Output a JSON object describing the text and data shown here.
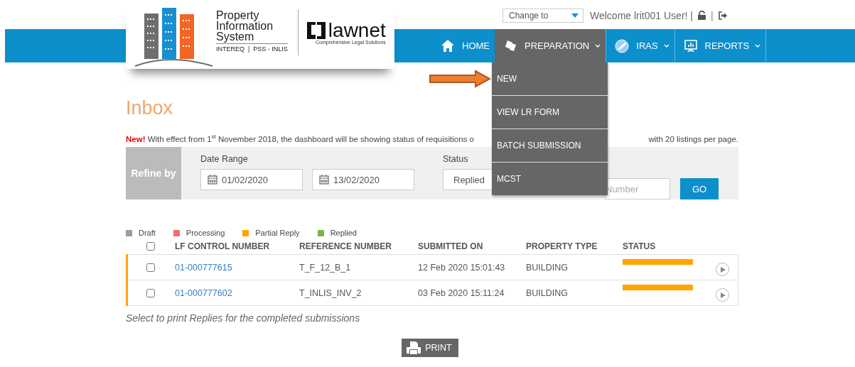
{
  "logo": {
    "title_lines": [
      "Property",
      "Information",
      "System"
    ],
    "tagline": "INTEREQ  |  PSS - INLIS",
    "partner": "lawnet",
    "partner_tagline": "Comprehensive Legal Solutions"
  },
  "top_bar": {
    "role_select": "Change to",
    "welcome": "Welcome lrit001 User!",
    "separator": "|"
  },
  "nav": [
    {
      "label": "HOME",
      "kind": "home",
      "dropdown": false,
      "selected": false
    },
    {
      "label": "PREPARATION",
      "kind": "documents",
      "dropdown": true,
      "selected": true
    },
    {
      "label": "IRAS",
      "kind": "globe",
      "dropdown": true,
      "selected": false
    },
    {
      "label": "REPORTS",
      "kind": "reports",
      "dropdown": true,
      "selected": false
    }
  ],
  "menu": [
    {
      "label": "NEW"
    },
    {
      "label": "VIEW LR FORM"
    },
    {
      "label": "BATCH SUBMISSION"
    },
    {
      "label": "MCST"
    }
  ],
  "page_title": "Inbox",
  "notice": {
    "badge": "New!",
    "text_before": "With effect from 1$^{st}$ November 2018, the dashboard will be showing status of requisitions o",
    "text_after": "with 20 listings per page."
  },
  "refine": {
    "label": "Refine by",
    "date_label": "Date Range",
    "date_from": "01/02/2020",
    "date_to": "13/02/2020",
    "status_label": "Status",
    "status_value": "Replied",
    "number_placeholder": "Number",
    "go": "GO"
  },
  "legend": [
    {
      "label": "Draft",
      "color": "#a09b96"
    },
    {
      "label": "Processing",
      "color": "#f26d6d"
    },
    {
      "label": "Partial Reply",
      "color": "#ffa500"
    },
    {
      "label": "Replied",
      "color": "#7ab648"
    }
  ],
  "table": {
    "columns": [
      "LF CONTROL NUMBER",
      "REFERENCE NUMBER",
      "SUBMITTED ON",
      "PROPERTY TYPE",
      "STATUS"
    ],
    "select_all": false,
    "rows": [
      {
        "checked": false,
        "control": "01-000777615",
        "reference": "T_F_12_B_1",
        "submitted": "12 Feb 2020 15:01:43",
        "type": "BUILDING",
        "color": "#ffa500"
      },
      {
        "checked": false,
        "control": "01-000777602",
        "reference": "T_INLIS_INV_2",
        "submitted": "03 Feb 2020 15:11:24",
        "type": "BUILDING",
        "color": "#ffa500"
      }
    ]
  },
  "footnote": "Select to print Replies for the completed submissions",
  "print_button": "PRINT"
}
